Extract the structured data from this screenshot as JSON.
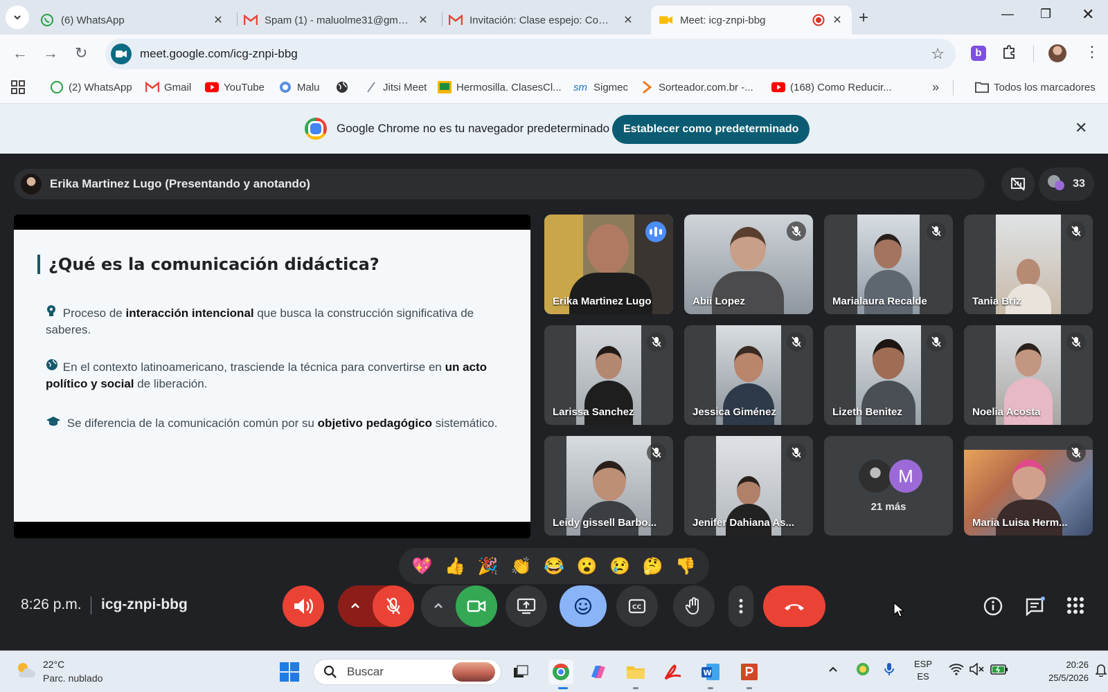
{
  "browser": {
    "tabs": [
      {
        "title": "(6) WhatsApp",
        "icon": "whatsapp-icon"
      },
      {
        "title": "Spam (1) - maluolme31@gmail.com",
        "icon": "gmail-icon"
      },
      {
        "title": "Invitación: Clase espejo: Comunicación",
        "icon": "gmail-icon"
      },
      {
        "title": "Meet: icg-znpi-bbg",
        "icon": "meet-icon",
        "active": true
      }
    ],
    "url": "meet.google.com/icg-znpi-bbg",
    "bookmarks": [
      {
        "label": "(2) WhatsApp",
        "icon": "whatsapp-icon"
      },
      {
        "label": "Gmail",
        "icon": "gmail-icon"
      },
      {
        "label": "YouTube",
        "icon": "youtube-icon"
      },
      {
        "label": "Malu",
        "icon": "malu-icon"
      },
      {
        "label": "",
        "icon": "globe-icon"
      },
      {
        "label": "Jitsi Meet",
        "icon": "jitsi-icon"
      },
      {
        "label": "Hermosilla. ClasesCl...",
        "icon": "classroom-icon"
      },
      {
        "label": "Sigmec",
        "icon": "sigmec-icon"
      },
      {
        "label": "Sorteador.com.br -...",
        "icon": "sorteador-icon"
      },
      {
        "label": "(168) Como Reducir...",
        "icon": "youtube-icon"
      }
    ],
    "all_bookmarks": "Todos los marcadores"
  },
  "infobar": {
    "message": "Google Chrome no es tu navegador predeterminado",
    "button": "Establecer como predeterminado"
  },
  "meet": {
    "presenter": "Erika Martinez Lugo (Presentando y anotando)",
    "participant_count": "33",
    "slide": {
      "title": "¿Qué es la comunicación didáctica?",
      "bullets": [
        {
          "pre": "Proceso de ",
          "bold": "interacción intencional",
          "post": " que busca la construcción significativa de saberes."
        },
        {
          "pre": "En el contexto latinoamericano, trasciende la técnica para convertirse en ",
          "bold": "un acto político y social",
          "post": " de liberación."
        },
        {
          "pre": "Se diferencia de la comunicación común por su ",
          "bold": "objetivo pedagógico",
          "post": " sistemático."
        }
      ]
    },
    "participants": [
      {
        "name": "Erika Martinez Lugo",
        "speaking": true
      },
      {
        "name": "Abii Lopez"
      },
      {
        "name": "Marialaura Recalde"
      },
      {
        "name": "Tania Briz"
      },
      {
        "name": "Larissa Sanchez"
      },
      {
        "name": "Jessica Giménez"
      },
      {
        "name": "Lizeth Benitez"
      },
      {
        "name": "Noelia Acosta"
      },
      {
        "name": "Leidy gissell Barbo..."
      },
      {
        "name": "Jenifer Dahiana As..."
      },
      {
        "name": "21 más",
        "more": true,
        "avatar_letter": "M"
      },
      {
        "name": "Maria Luisa Herm..."
      }
    ],
    "reactions": [
      "💖",
      "👍",
      "🎉",
      "👏",
      "😂",
      "😮",
      "😢",
      "🤔",
      "👎"
    ],
    "time": "8:26 p.m.",
    "meeting_code": "icg-znpi-bbg"
  },
  "taskbar": {
    "temperature": "22°C",
    "condition": "Parc. nublado",
    "search_placeholder": "Buscar",
    "lang_top": "ESP",
    "lang_bottom": "ES",
    "clock_time": "20:26",
    "clock_date": "25/5/2026"
  },
  "colors": {
    "meet_bg": "#202124",
    "end_call": "#ea4335",
    "camera_on": "#34a853",
    "reactions_active": "#8ab4f8",
    "infobar_button": "#0b5c73"
  }
}
